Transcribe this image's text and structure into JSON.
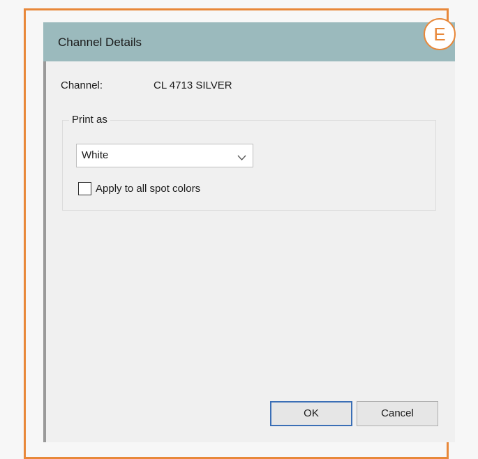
{
  "badge": "E",
  "dialog": {
    "title": "Channel Details",
    "channel_label": "Channel:",
    "channel_value": "CL 4713 SILVER",
    "print_as": {
      "legend": "Print as",
      "selected": "White",
      "apply_all_label": "Apply to all spot colors",
      "apply_all_checked": false
    },
    "ok_label": "OK",
    "cancel_label": "Cancel"
  },
  "colors": {
    "titlebar": "#9bbabd",
    "accent_frame": "#e8883a",
    "ok_border": "#3b6fb6"
  }
}
